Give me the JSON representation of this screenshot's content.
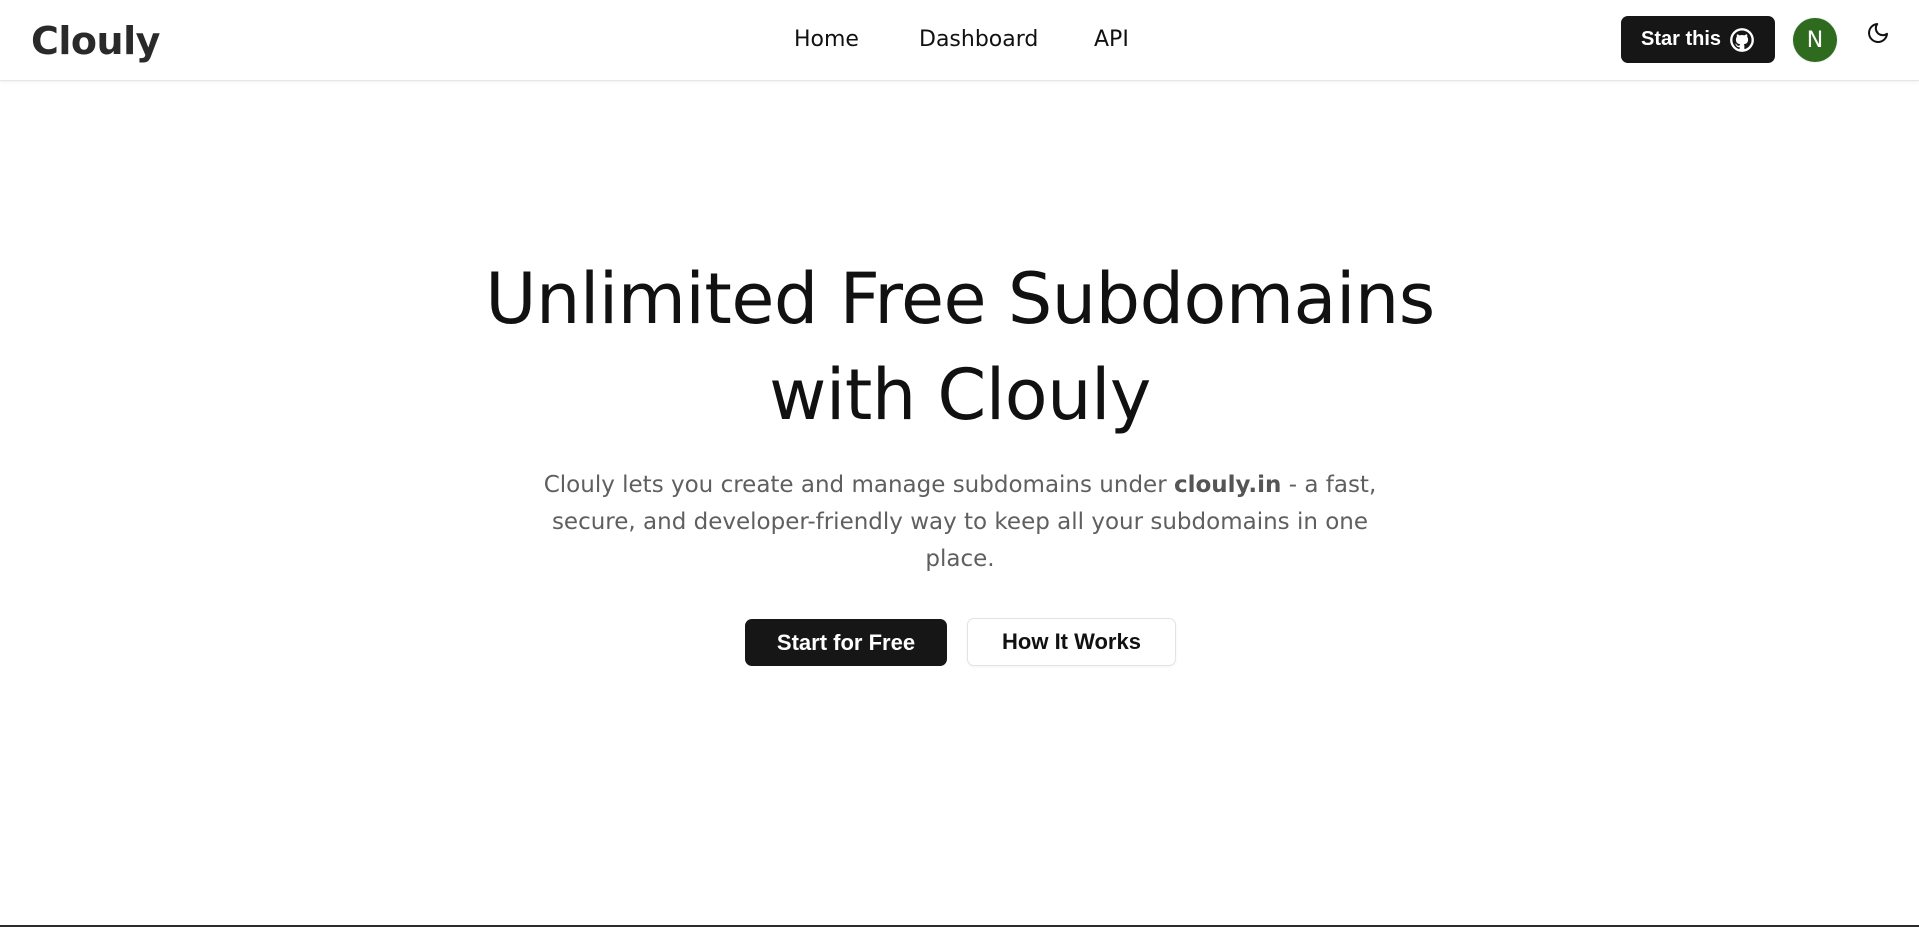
{
  "header": {
    "logo": "Clouly",
    "nav": [
      {
        "label": "Home"
      },
      {
        "label": "Dashboard"
      },
      {
        "label": "API"
      }
    ],
    "star_button_label": "Star this",
    "star_button_icon": "github-icon",
    "avatar_initial": "N",
    "avatar_color": "#2f6b1f",
    "theme_toggle_icon": "moon-icon"
  },
  "hero": {
    "title_line1": "Unlimited Free Subdomains",
    "title_line2": "with Clouly",
    "subtitle_before": "Clouly lets you create and manage subdomains under ",
    "subtitle_domain": "clouly.in",
    "subtitle_after": " - a fast, secure, and developer-friendly way to keep all your subdomains in one place.",
    "primary_cta": "Start for Free",
    "secondary_cta": "How It Works"
  },
  "colors": {
    "primary_button": "#161616",
    "text": "#111111",
    "muted_text": "#5f5f5f",
    "background": "#ffffff"
  }
}
